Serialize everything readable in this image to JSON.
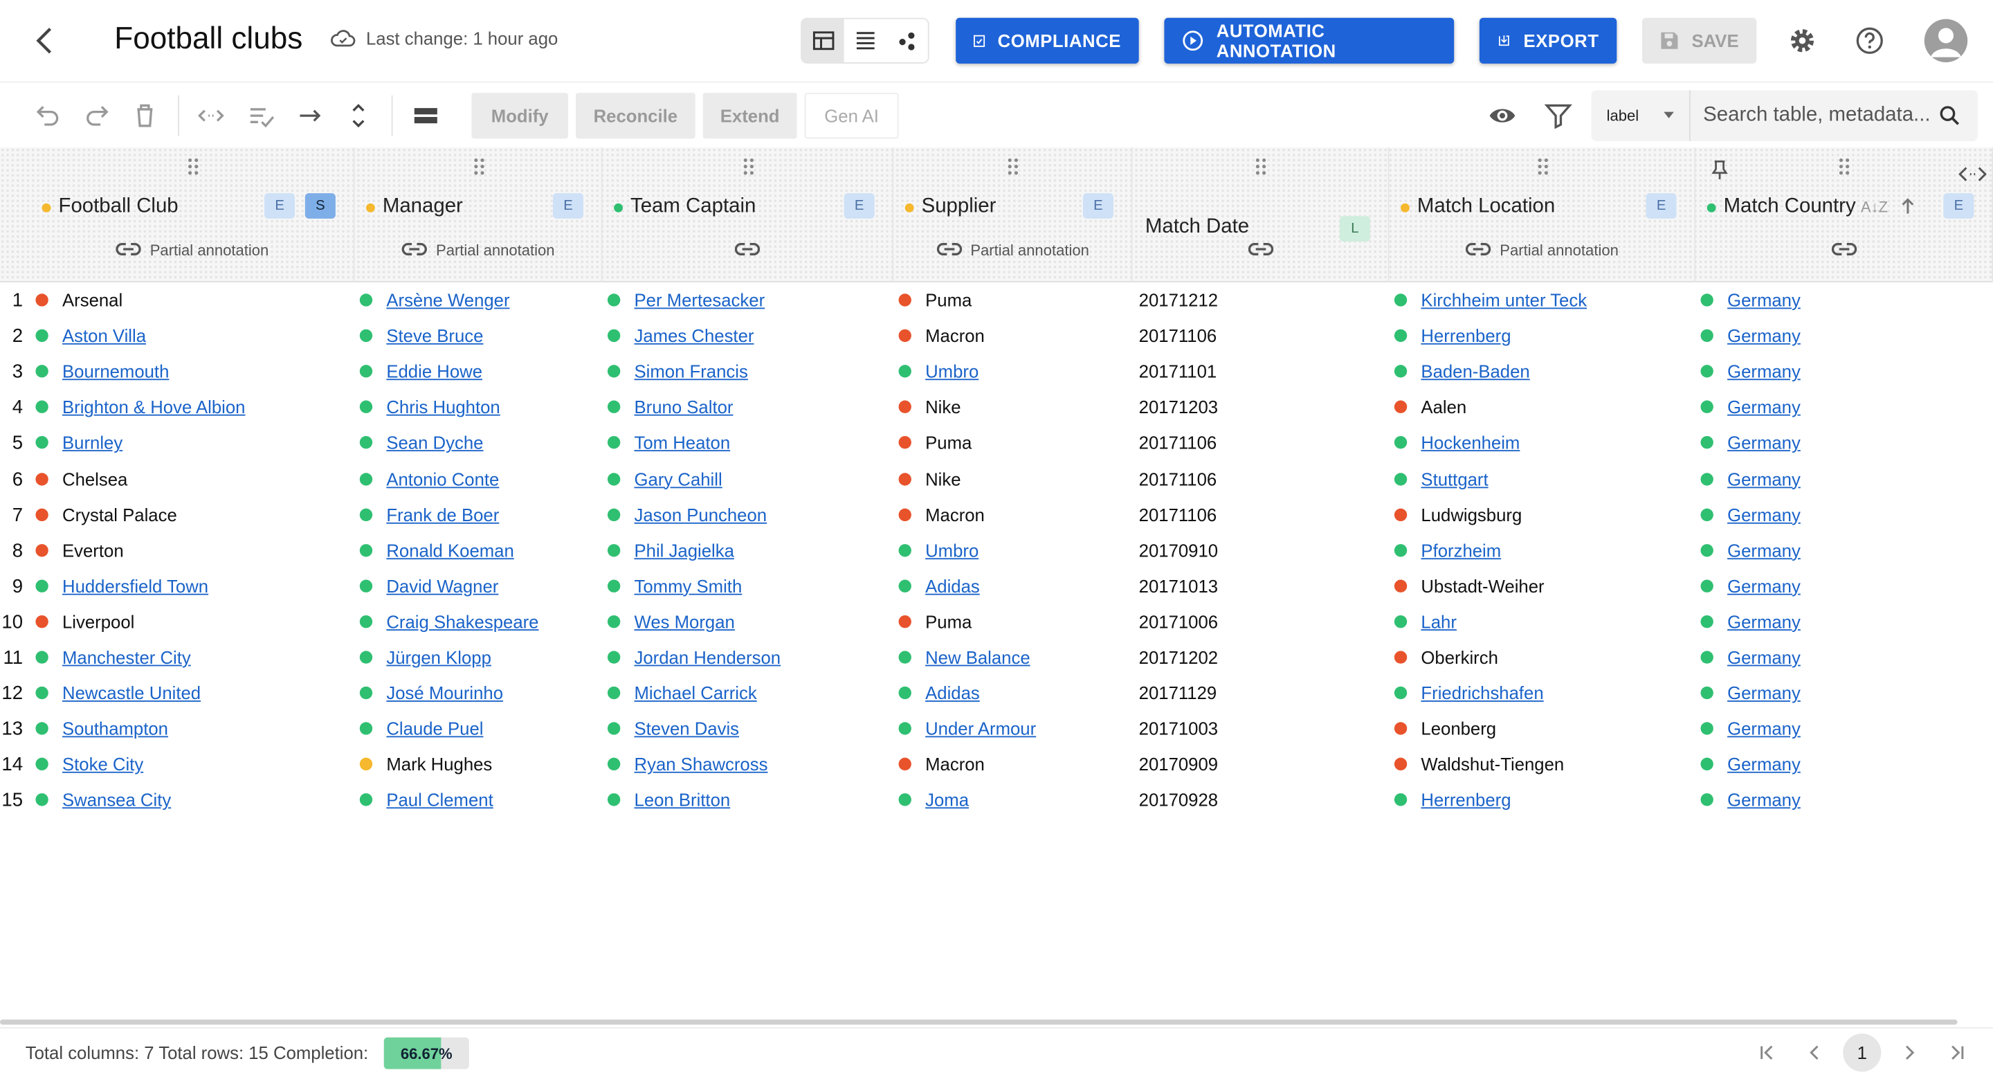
{
  "header": {
    "title": "Football clubs",
    "last_change": "Last change: 1 hour ago",
    "buttons": {
      "compliance": "COMPLIANCE",
      "automatic_annotation": "AUTOMATIC ANNOTATION",
      "export": "EXPORT",
      "save": "SAVE"
    }
  },
  "toolbar": {
    "modify": "Modify",
    "reconcile": "Reconcile",
    "extend": "Extend",
    "gen_ai": "Gen AI",
    "search_type": "label",
    "search_placeholder": "Search table, metadata..."
  },
  "columns": [
    {
      "label": "Football Club",
      "dot": "#f5b82e",
      "tags": [
        "E",
        "S"
      ],
      "annotation": "Partial annotation"
    },
    {
      "label": "Manager",
      "dot": "#f5b82e",
      "tags": [
        "E"
      ],
      "annotation": "Partial annotation"
    },
    {
      "label": "Team Captain",
      "dot": "#2fbf71",
      "tags": [
        "E"
      ],
      "annotation": ""
    },
    {
      "label": "Supplier",
      "dot": "#f5b82e",
      "tags": [
        "E"
      ],
      "annotation": "Partial annotation"
    },
    {
      "label": "Match Date",
      "dot": "",
      "tags": [
        "L"
      ],
      "annotation": ""
    },
    {
      "label": "Match Location",
      "dot": "#f5b82e",
      "tags": [
        "E"
      ],
      "annotation": "Partial annotation"
    },
    {
      "label": "Match Country",
      "dot": "#2fbf71",
      "tags": [
        "E"
      ],
      "annotation": ""
    }
  ],
  "status_colors": {
    "g": "#2fbf71",
    "r": "#e8532b",
    "y": "#f5b82e"
  },
  "rows": [
    [
      [
        "Arsenal",
        "r"
      ],
      [
        "Arsène Wenger",
        "g"
      ],
      [
        "Per Mertesacker",
        "g"
      ],
      [
        "Puma",
        "r"
      ],
      [
        "20171212",
        ""
      ],
      [
        "Kirchheim unter Teck",
        "g"
      ],
      [
        "Germany",
        "g"
      ]
    ],
    [
      [
        "Aston Villa",
        "g"
      ],
      [
        "Steve Bruce",
        "g"
      ],
      [
        "James Chester",
        "g"
      ],
      [
        "Macron",
        "r"
      ],
      [
        "20171106",
        ""
      ],
      [
        "Herrenberg",
        "g"
      ],
      [
        "Germany",
        "g"
      ]
    ],
    [
      [
        "Bournemouth",
        "g"
      ],
      [
        "Eddie Howe",
        "g"
      ],
      [
        "Simon Francis",
        "g"
      ],
      [
        "Umbro",
        "g"
      ],
      [
        "20171101",
        ""
      ],
      [
        "Baden-Baden",
        "g"
      ],
      [
        "Germany",
        "g"
      ]
    ],
    [
      [
        "Brighton & Hove Albion",
        "g"
      ],
      [
        "Chris Hughton",
        "g"
      ],
      [
        "Bruno Saltor",
        "g"
      ],
      [
        "Nike",
        "r"
      ],
      [
        "20171203",
        ""
      ],
      [
        "Aalen",
        "r"
      ],
      [
        "Germany",
        "g"
      ]
    ],
    [
      [
        "Burnley",
        "g"
      ],
      [
        "Sean Dyche",
        "g"
      ],
      [
        "Tom Heaton",
        "g"
      ],
      [
        "Puma",
        "r"
      ],
      [
        "20171106",
        ""
      ],
      [
        "Hockenheim",
        "g"
      ],
      [
        "Germany",
        "g"
      ]
    ],
    [
      [
        "Chelsea",
        "r"
      ],
      [
        "Antonio Conte",
        "g"
      ],
      [
        "Gary Cahill",
        "g"
      ],
      [
        "Nike",
        "r"
      ],
      [
        "20171106",
        ""
      ],
      [
        "Stuttgart",
        "g"
      ],
      [
        "Germany",
        "g"
      ]
    ],
    [
      [
        "Crystal Palace",
        "r"
      ],
      [
        "Frank de Boer",
        "g"
      ],
      [
        "Jason Puncheon",
        "g"
      ],
      [
        "Macron",
        "r"
      ],
      [
        "20171106",
        ""
      ],
      [
        "Ludwigsburg",
        "r"
      ],
      [
        "Germany",
        "g"
      ]
    ],
    [
      [
        "Everton",
        "r"
      ],
      [
        "Ronald Koeman",
        "g"
      ],
      [
        "Phil Jagielka",
        "g"
      ],
      [
        "Umbro",
        "g"
      ],
      [
        "20170910",
        ""
      ],
      [
        "Pforzheim",
        "g"
      ],
      [
        "Germany",
        "g"
      ]
    ],
    [
      [
        "Huddersfield Town",
        "g"
      ],
      [
        "David Wagner",
        "g"
      ],
      [
        "Tommy Smith",
        "g"
      ],
      [
        "Adidas",
        "g"
      ],
      [
        "20171013",
        ""
      ],
      [
        "Ubstadt-Weiher",
        "r"
      ],
      [
        "Germany",
        "g"
      ]
    ],
    [
      [
        "Liverpool",
        "r"
      ],
      [
        "Craig Shakespeare",
        "g"
      ],
      [
        "Wes Morgan",
        "g"
      ],
      [
        "Puma",
        "r"
      ],
      [
        "20171006",
        ""
      ],
      [
        "Lahr",
        "g"
      ],
      [
        "Germany",
        "g"
      ]
    ],
    [
      [
        "Manchester City",
        "g"
      ],
      [
        "Jürgen Klopp",
        "g"
      ],
      [
        "Jordan Henderson",
        "g"
      ],
      [
        "New Balance",
        "g"
      ],
      [
        "20171202",
        ""
      ],
      [
        "Oberkirch",
        "r"
      ],
      [
        "Germany",
        "g"
      ]
    ],
    [
      [
        "Newcastle United",
        "g"
      ],
      [
        "José Mourinho",
        "g"
      ],
      [
        "Michael Carrick",
        "g"
      ],
      [
        "Adidas",
        "g"
      ],
      [
        "20171129",
        ""
      ],
      [
        "Friedrichshafen",
        "g"
      ],
      [
        "Germany",
        "g"
      ]
    ],
    [
      [
        "Southampton",
        "g"
      ],
      [
        "Claude Puel",
        "g"
      ],
      [
        "Steven Davis",
        "g"
      ],
      [
        "Under Armour",
        "g"
      ],
      [
        "20171003",
        ""
      ],
      [
        "Leonberg",
        "r"
      ],
      [
        "Germany",
        "g"
      ]
    ],
    [
      [
        "Stoke City",
        "g"
      ],
      [
        "Mark Hughes",
        "y"
      ],
      [
        "Ryan Shawcross",
        "g"
      ],
      [
        "Macron",
        "r"
      ],
      [
        "20170909",
        ""
      ],
      [
        "Waldshut-Tiengen",
        "r"
      ],
      [
        "Germany",
        "g"
      ]
    ],
    [
      [
        "Swansea City",
        "g"
      ],
      [
        "Paul Clement",
        "g"
      ],
      [
        "Leon Britton",
        "g"
      ],
      [
        "Joma",
        "g"
      ],
      [
        "20170928",
        ""
      ],
      [
        "Herrenberg",
        "g"
      ],
      [
        "Germany",
        "g"
      ]
    ]
  ],
  "footer": {
    "summary": "Total columns: 7 Total rows: 15 Completion:",
    "completion": "66.67%",
    "completion_value": 0.6667,
    "page": "1"
  }
}
